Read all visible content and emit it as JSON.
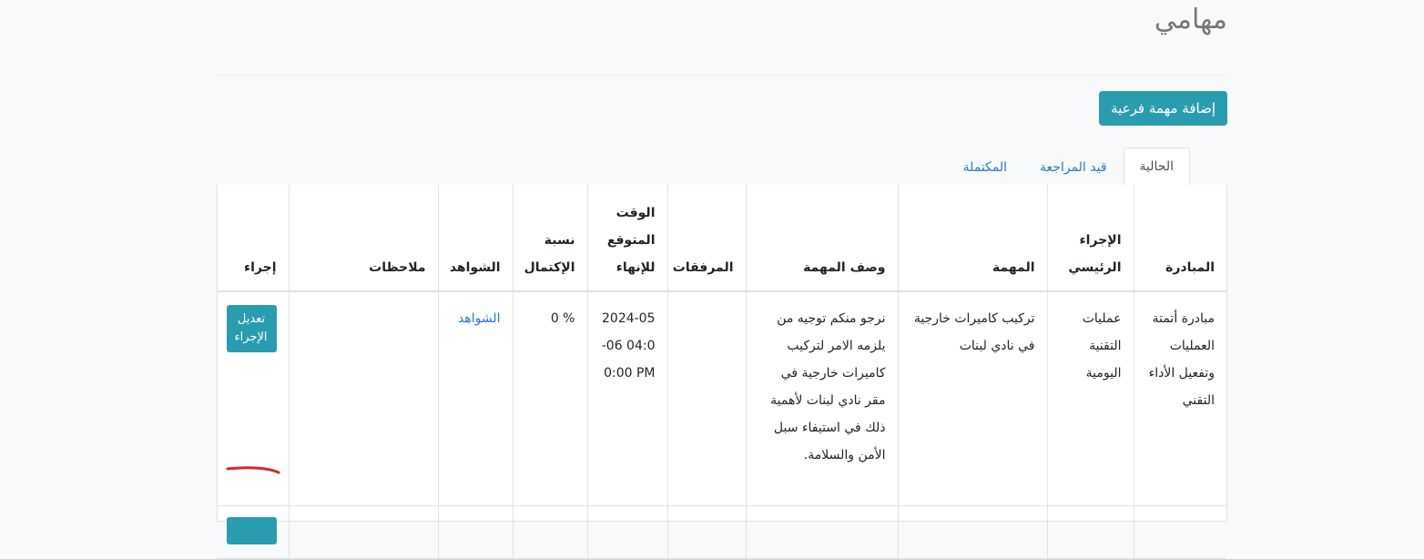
{
  "page": {
    "title": "مهامي",
    "add_subtask_label": "إضافة مهمة فرعية"
  },
  "tabs": [
    {
      "label": "الحالية",
      "active": true
    },
    {
      "label": "قيد المراجعة",
      "active": false
    },
    {
      "label": "المكتملة",
      "active": false
    }
  ],
  "table": {
    "headers": {
      "initiative": "المبادرة",
      "main_action": "الإجراء الرئيسي",
      "task": "المهمة",
      "description": "وصف المهمة",
      "attachments": "المرفقات",
      "expected_end": "الوقت المتوقع للإنهاء",
      "completion": "نسبة الإكتمال",
      "evidence": "الشواهد",
      "notes": "ملاحظات",
      "action": "إجراء"
    },
    "rows": [
      {
        "initiative": "مبادرة أتمتة العمليات وتفعيل الأداء التقني",
        "main_action": "عمليات التقنية اليومية",
        "task": "تركيب كاميرات خارجية في نادي لبنات",
        "description": "نرجو منكم توجيه من يلزمه الامر لتركيب كاميرات خارجية في مقر نادي لبنات لأهمية ذلك في استيفاء سبل الأمن والسلامة.",
        "attachments": "",
        "expected_end": "2024-05-06 04:00:00 PM",
        "completion": "0 %",
        "evidence": "الشواهد",
        "notes": "",
        "action_label": "تعديل الإجراء"
      },
      {
        "initiative": "",
        "main_action": "",
        "task": "",
        "description": "",
        "attachments": "",
        "expected_end": "",
        "completion": "",
        "evidence": "",
        "notes": "",
        "action_label": ""
      }
    ]
  },
  "colors": {
    "accent": "#2a9cb0",
    "link": "#2a7ac9",
    "annotation": "#d9262c"
  }
}
